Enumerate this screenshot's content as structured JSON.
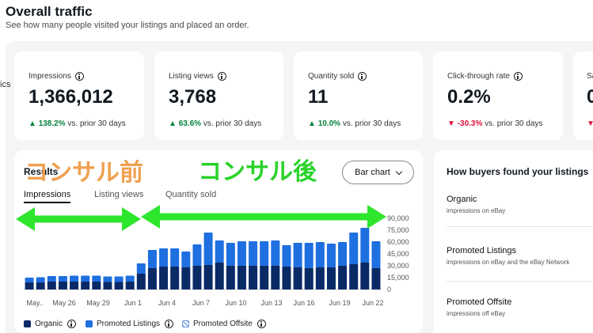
{
  "header": {
    "title": "Overall traffic",
    "subtitle": "See how many people visited your listings and placed an order."
  },
  "left_edge_text": "ics",
  "kpis": [
    {
      "label": "Impressions",
      "value": "1,366,012",
      "delta": "138.2%",
      "direction": "up",
      "suffix": "vs. prior 30 days"
    },
    {
      "label": "Listing views",
      "value": "3,768",
      "delta": "63.6%",
      "direction": "up",
      "suffix": "vs. prior 30 days"
    },
    {
      "label": "Quantity sold",
      "value": "11",
      "delta": "10.0%",
      "direction": "up",
      "suffix": "vs. prior 30 days"
    },
    {
      "label": "Click-through rate",
      "value": "0.2%",
      "delta": "-30.3%",
      "direction": "down",
      "suffix": "vs. prior 30 days"
    },
    {
      "label": "Sa",
      "value": "0",
      "delta": "",
      "direction": "down",
      "suffix": ""
    }
  ],
  "results": {
    "title": "Results",
    "chart_type_button": "Bar chart",
    "tabs": [
      "Impressions",
      "Listing views",
      "Quantity sold"
    ],
    "active_tab": 0
  },
  "annotations": {
    "before": "コンサル前",
    "after": "コンサル後"
  },
  "chart_data": {
    "type": "bar",
    "stacked": true,
    "x_tick_labels": [
      "May..",
      "May 26",
      "May 29",
      "Jun 1",
      "Jun 4",
      "Jun 7",
      "Jun 10",
      "Jun 13",
      "Jun 16",
      "Jun 19",
      "Jun 22"
    ],
    "y_tick_labels": [
      "90,000",
      "75,000",
      "60,000",
      "45,000",
      "30,000",
      "15,000",
      "0"
    ],
    "ylim": [
      0,
      90000
    ],
    "y_ticks": [
      90000,
      75000,
      60000,
      45000,
      30000,
      15000,
      0
    ],
    "series": [
      {
        "name": "Organic",
        "color": "#0a2a66",
        "values": [
          9000,
          9000,
          10000,
          10000,
          10000,
          10000,
          10000,
          9500,
          9500,
          10000,
          20000,
          27000,
          29000,
          29000,
          28000,
          30000,
          31000,
          34000,
          30000,
          30000,
          30000,
          30000,
          30000,
          29000,
          28000,
          27000,
          28000,
          28000,
          30000,
          32000,
          34000,
          27000
        ]
      },
      {
        "name": "Promoted Listings",
        "color": "#1e6fe0",
        "values": [
          6000,
          6500,
          7000,
          7000,
          7500,
          7500,
          7500,
          7000,
          7000,
          7500,
          13000,
          23000,
          23000,
          23000,
          20000,
          27000,
          41000,
          28000,
          29000,
          31000,
          31000,
          31000,
          32000,
          27000,
          31000,
          32000,
          32000,
          30000,
          30000,
          40000,
          44000,
          34000
        ]
      },
      {
        "name": "Promoted Offsite",
        "color": "#8fb4ea",
        "values": []
      }
    ]
  },
  "legend": [
    "Organic",
    "Promoted Listings",
    "Promoted Offsite"
  ],
  "buyers": {
    "title": "How buyers found your listings",
    "sources": [
      {
        "name": "Organic",
        "desc": "impressions on eBay"
      },
      {
        "name": "Promoted Listings",
        "desc": "impressions on eBay and the eBay Network"
      },
      {
        "name": "Promoted Offsite",
        "desc": "impressions off eBay"
      }
    ]
  }
}
